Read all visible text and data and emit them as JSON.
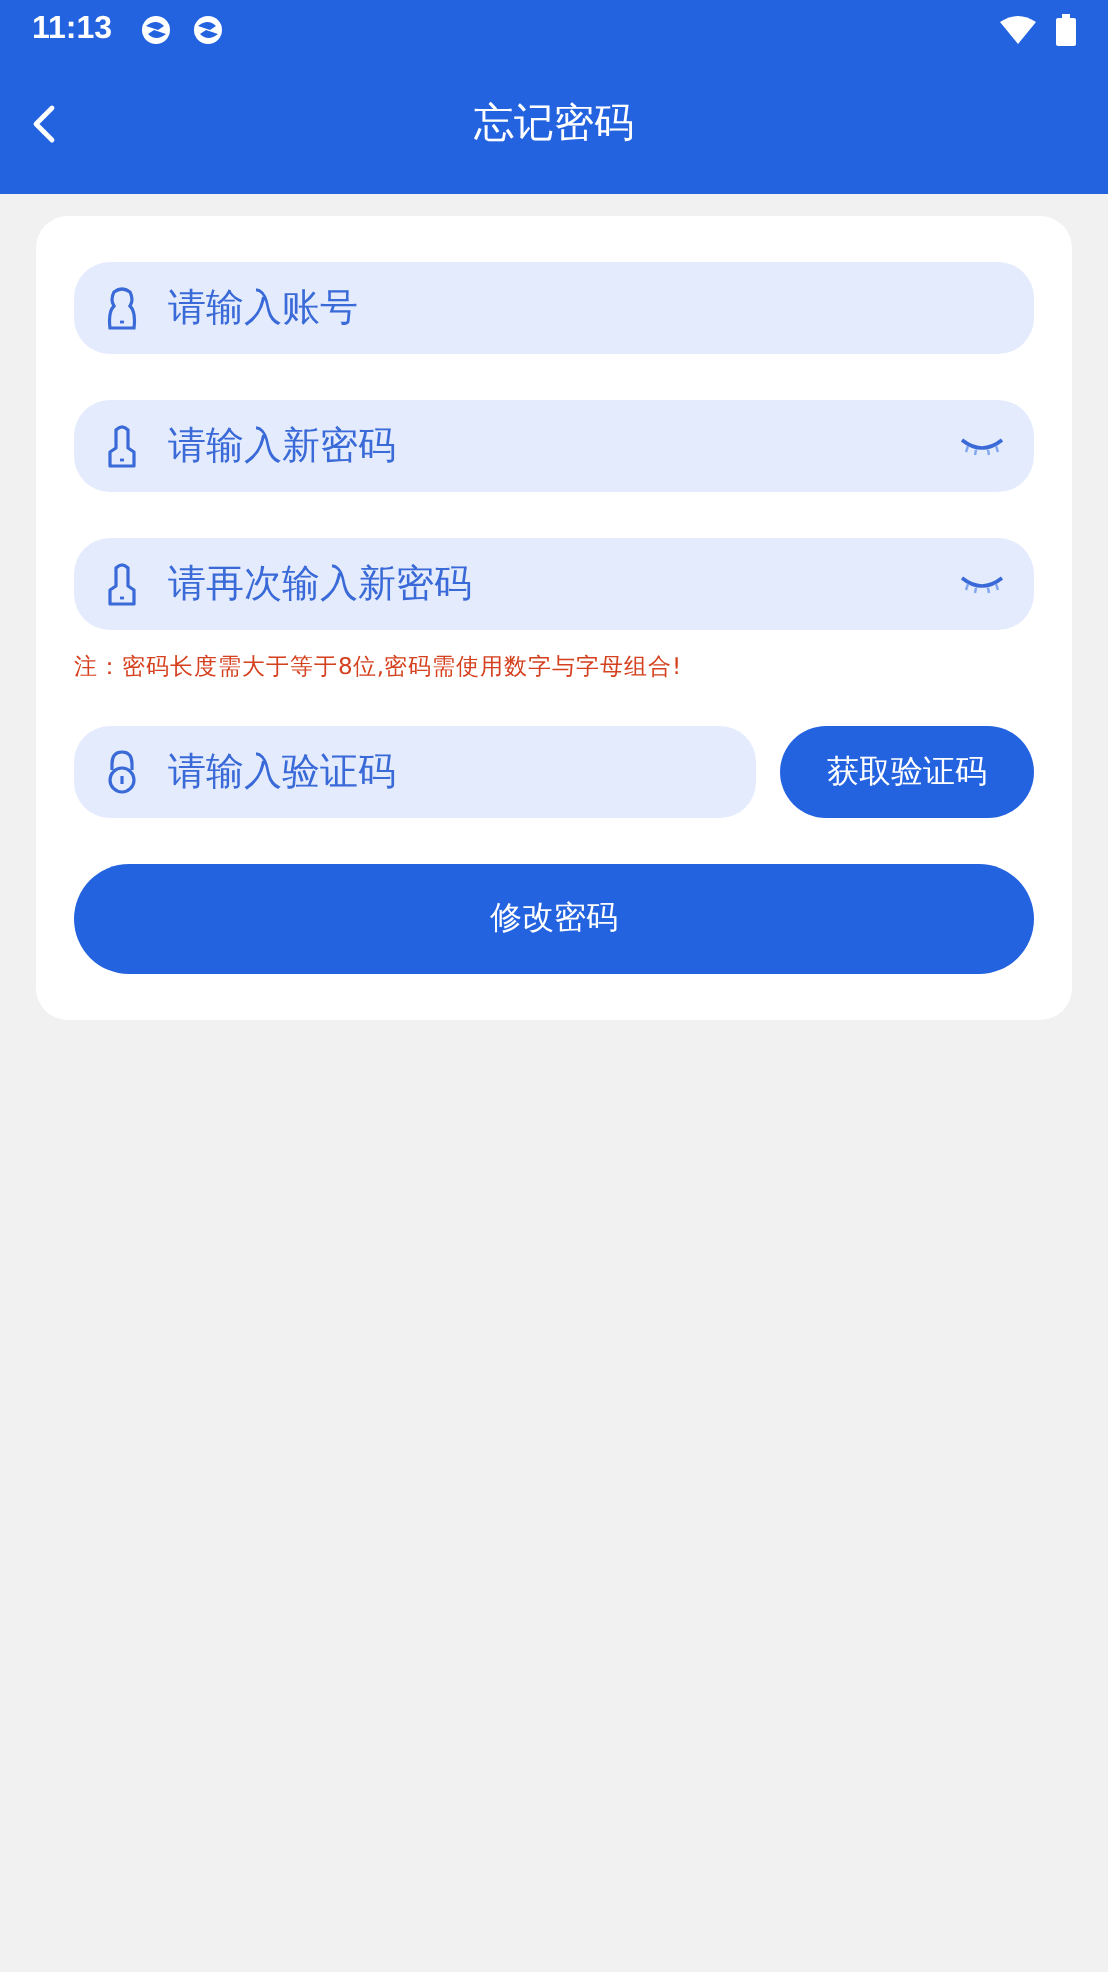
{
  "status_bar": {
    "time": "11:13"
  },
  "header": {
    "title": "忘记密码"
  },
  "fields": [
    {
      "kind": "account",
      "placeholder": "请输入账号"
    },
    {
      "kind": "password",
      "placeholder": "请输入新密码",
      "hidden": true
    },
    {
      "kind": "password",
      "placeholder": "请再次输入新密码",
      "hidden": true
    }
  ],
  "note": "注：密码长度需大于等于8位,密码需使用数字与字母组合!",
  "code_field": {
    "kind": "code",
    "placeholder": "请输入验证码"
  },
  "code_button": "获取验证码",
  "submit_button": "修改密码"
}
